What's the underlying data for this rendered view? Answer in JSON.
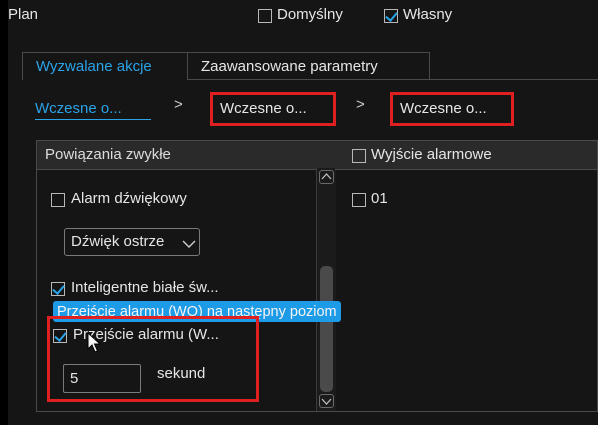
{
  "header": {
    "title": "Plan",
    "default_label": "Domyślny",
    "default_checked": false,
    "custom_label": "Własny",
    "custom_checked": true
  },
  "tabs": [
    {
      "label": "Wyzwalane akcje",
      "active": true
    },
    {
      "label": "Zaawansowane parametry",
      "active": false
    }
  ],
  "steps": [
    {
      "label": "Wczesne o...",
      "active": true
    },
    {
      "label": "Wczesne o...",
      "active": false
    },
    {
      "label": "Wczesne o...",
      "active": false
    }
  ],
  "step_separator": ">",
  "left_pane": {
    "header": "Powiązania zwykłe",
    "audible_alarm_label": "Alarm dźwiękowy",
    "audible_alarm_checked": false,
    "sound_select_value": "Dźwięk ostrze",
    "white_light_label": "Inteligentne białe św...",
    "white_light_checked": true,
    "tooltip": "Przejście alarmu (WO) na następny poziom",
    "transition_label": "Przejście alarmu (W...",
    "transition_checked": true,
    "seconds_value": "5",
    "seconds_unit": "sekund"
  },
  "right_pane": {
    "header": "Wyjście alarmowe",
    "header_checked": false,
    "items": [
      {
        "label": "01",
        "checked": false
      }
    ]
  },
  "colors": {
    "accent": "#2aa3e8",
    "highlight": "#e02020",
    "tooltip_bg": "#1e9be6"
  }
}
